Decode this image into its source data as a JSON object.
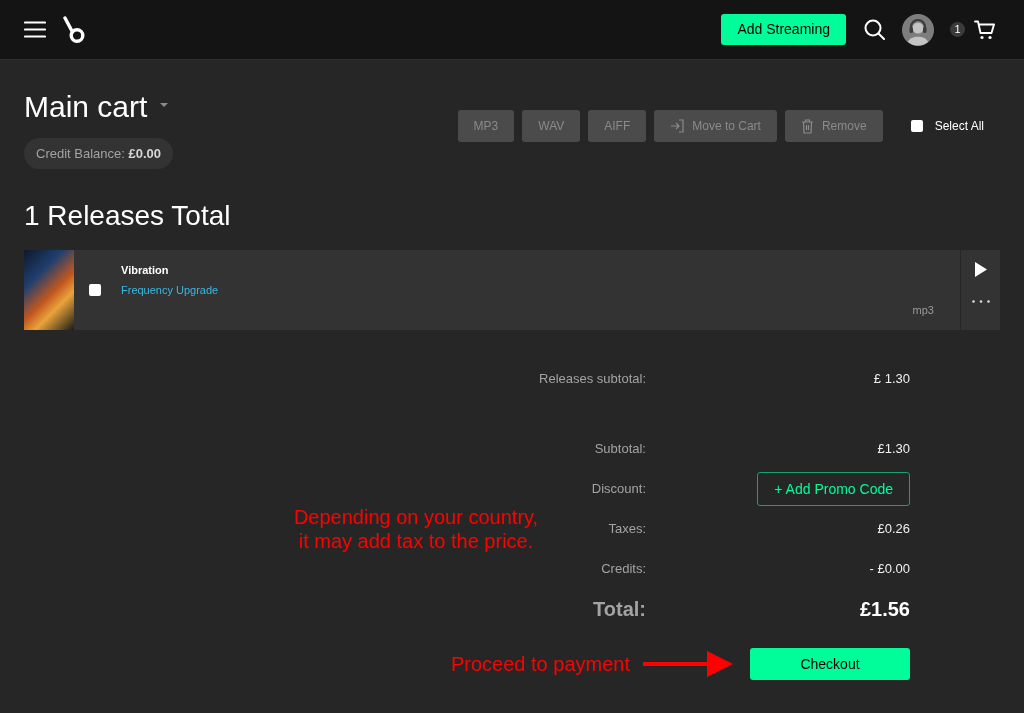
{
  "header": {
    "add_streaming_button": "Add Streaming",
    "cart_count": "1"
  },
  "cart": {
    "title": "Main cart",
    "credit_balance": "Credit Balance: **£0.00**"
  },
  "toolbar": {
    "buttons": [
      {
        "kind": "format",
        "label": "MP3",
        "disabled": true
      },
      {
        "kind": "format",
        "label": "WAV",
        "disabled": true
      },
      {
        "kind": "format",
        "label": "AIFF",
        "disabled": true
      },
      {
        "kind": "move",
        "label": "Move to Cart",
        "disabled": true
      },
      {
        "kind": "remove",
        "label": "Remove",
        "disabled": true
      }
    ],
    "select_all": {
      "label": "Select All",
      "checked": false
    }
  },
  "releases_heading": "1 Releases Total",
  "releases": [
    {
      "title": "Vibration",
      "artist": "Frequency Upgrade",
      "format": "mp3",
      "checked": false
    }
  ],
  "summary": {
    "releases_subtotal": {
      "label": "Releases subtotal:",
      "value": "£ 1.30"
    },
    "rows": [
      {
        "kind": "amount",
        "label": "Subtotal:",
        "value": "£1.30"
      },
      {
        "kind": "promo",
        "label": "Discount:",
        "value": "+ Add Promo Code"
      },
      {
        "kind": "amount",
        "label": "Taxes:",
        "value": "£0.26"
      },
      {
        "kind": "amount",
        "label": "Credits:",
        "value": "- £0.00"
      },
      {
        "kind": "total",
        "label": "Total:",
        "value": "£1.56"
      }
    ],
    "checkout_button": "Checkout"
  },
  "annotations": [
    {
      "kind": "note",
      "text": "Depending on your country,\nit may add tax to the price."
    },
    {
      "kind": "arrow",
      "text": "Proceed to payment"
    }
  ]
}
